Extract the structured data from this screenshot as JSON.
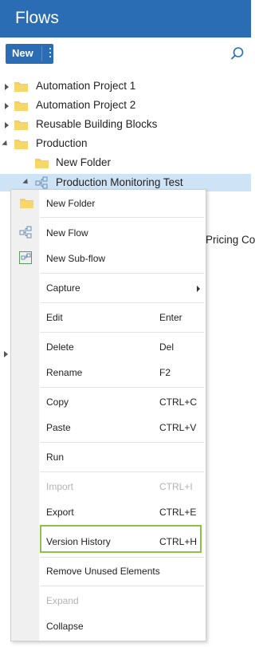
{
  "header": {
    "title": "Flows"
  },
  "toolbar": {
    "new_label": "New"
  },
  "tree": {
    "items": [
      {
        "label": "Automation Project 1"
      },
      {
        "label": "Automation Project 2"
      },
      {
        "label": "Reusable Building Blocks"
      },
      {
        "label": "Production"
      },
      {
        "label": "New Folder"
      },
      {
        "label": "Production Monitoring Test"
      }
    ],
    "peek_text": "Pricing Co"
  },
  "context_menu": {
    "items": [
      {
        "label": "New Folder"
      },
      {
        "label": "New Flow"
      },
      {
        "label": "New Sub-flow"
      },
      {
        "label": "Capture"
      },
      {
        "label": "Edit",
        "shortcut": "Enter"
      },
      {
        "label": "Delete",
        "shortcut": "Del"
      },
      {
        "label": "Rename",
        "shortcut": "F2"
      },
      {
        "label": "Copy",
        "shortcut": "CTRL+C"
      },
      {
        "label": "Paste",
        "shortcut": "CTRL+V"
      },
      {
        "label": "Run"
      },
      {
        "label": "Import",
        "shortcut": "CTRL+I"
      },
      {
        "label": "Export",
        "shortcut": "CTRL+E"
      },
      {
        "label": "Version History",
        "shortcut": "CTRL+H"
      },
      {
        "label": "Remove Unused Elements"
      },
      {
        "label": "Expand"
      },
      {
        "label": "Collapse"
      }
    ]
  },
  "colors": {
    "accent": "#2b6db5",
    "selection": "#cfe3f7",
    "highlight_border": "#8bc34a",
    "folder": "#f5cf5a"
  }
}
